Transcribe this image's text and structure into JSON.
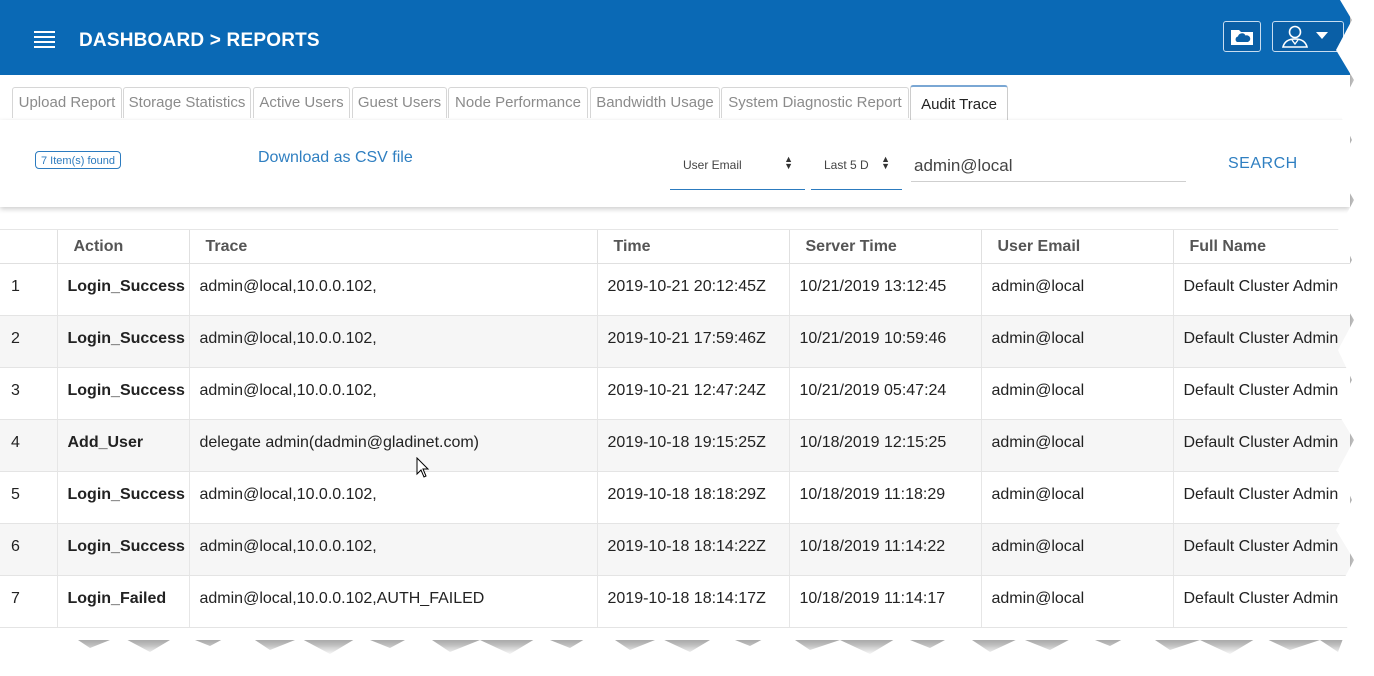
{
  "header": {
    "breadcrumb": "DASHBOARD > REPORTS",
    "menu_icon": "hamburger-menu-icon",
    "cloud_icon": "cloud-folder-icon",
    "user_icon": "user-account-icon",
    "brand_color": "#0a69b5"
  },
  "tabs": [
    {
      "label": "Upload Report"
    },
    {
      "label": "Storage Statistics"
    },
    {
      "label": "Active Users"
    },
    {
      "label": "Guest Users"
    },
    {
      "label": "Node Performance"
    },
    {
      "label": "Bandwidth Usage"
    },
    {
      "label": "System Diagnostic Report"
    },
    {
      "label": "Audit Trace",
      "active": true
    }
  ],
  "toolbar": {
    "count_badge": "7 Item(s) found",
    "csv_link": "Download as CSV file",
    "filter_field": "User Email",
    "date_range": "Last 5 D",
    "search_value": "admin@local",
    "search_button": "SEARCH"
  },
  "table": {
    "columns": [
      "",
      "Action",
      "Trace",
      "Time",
      "Server Time",
      "User Email",
      "Full Name"
    ],
    "rows": [
      [
        "1",
        "Login_Success",
        "admin@local,10.0.0.102,",
        "2019-10-21 20:12:45Z",
        "10/21/2019 13:12:45",
        "admin@local",
        "Default Cluster Admin"
      ],
      [
        "2",
        "Login_Success",
        "admin@local,10.0.0.102,",
        "2019-10-21 17:59:46Z",
        "10/21/2019 10:59:46",
        "admin@local",
        "Default Cluster Admin"
      ],
      [
        "3",
        "Login_Success",
        "admin@local,10.0.0.102,",
        "2019-10-21 12:47:24Z",
        "10/21/2019 05:47:24",
        "admin@local",
        "Default Cluster Admin"
      ],
      [
        "4",
        "Add_User",
        "delegate admin(dadmin@gladinet.com)",
        "2019-10-18 19:15:25Z",
        "10/18/2019 12:15:25",
        "admin@local",
        "Default Cluster Admin"
      ],
      [
        "5",
        "Login_Success",
        "admin@local,10.0.0.102,",
        "2019-10-18 18:18:29Z",
        "10/18/2019 11:18:29",
        "admin@local",
        "Default Cluster Admin"
      ],
      [
        "6",
        "Login_Success",
        "admin@local,10.0.0.102,",
        "2019-10-18 18:14:22Z",
        "10/18/2019 11:14:22",
        "admin@local",
        "Default Cluster Admin"
      ],
      [
        "7",
        "Login_Failed",
        "admin@local,10.0.0.102,AUTH_FAILED",
        "2019-10-18 18:14:17Z",
        "10/18/2019 11:14:17",
        "admin@local",
        "Default Cluster Admin"
      ]
    ]
  }
}
